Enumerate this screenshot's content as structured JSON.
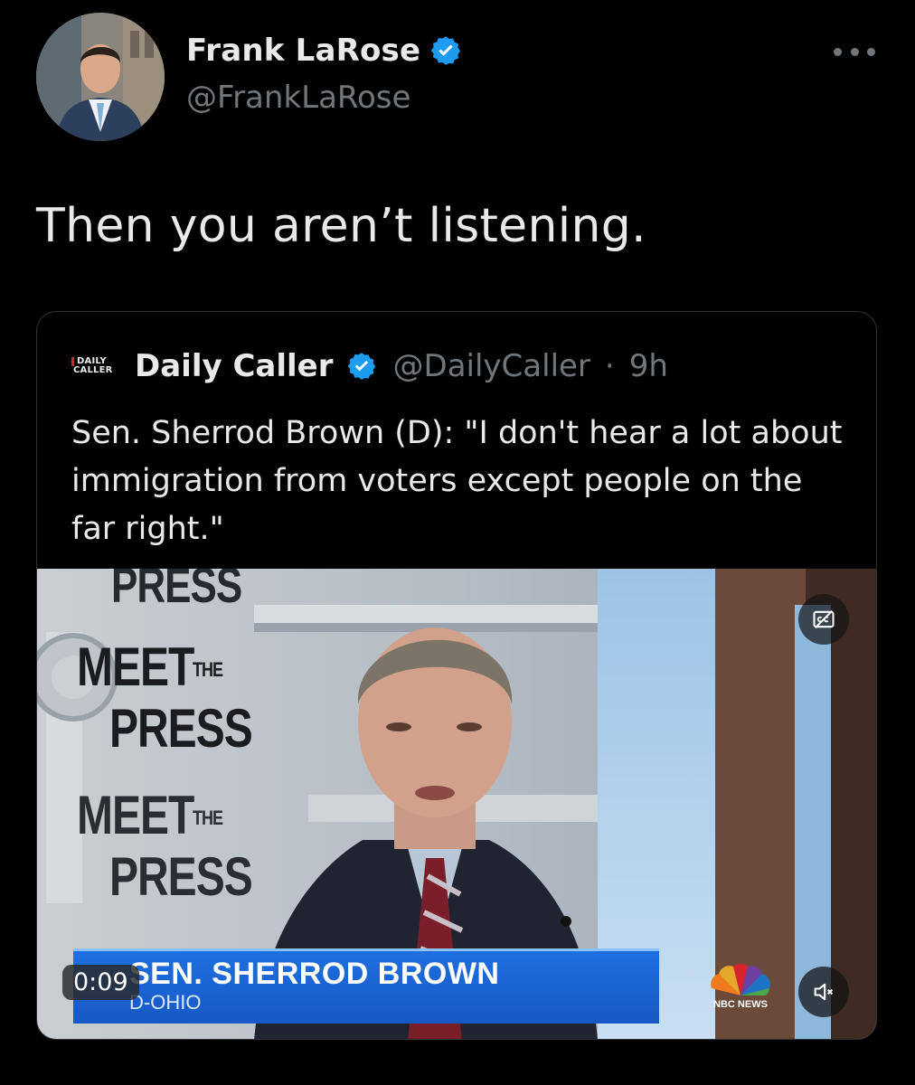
{
  "author": {
    "name": "Frank LaRose",
    "handle": "@FrankLaRose",
    "verified": true,
    "avatar_icon": "profile-photo"
  },
  "tweet": {
    "text": "Then you aren’t listening."
  },
  "quoted_tweet": {
    "logo_line1": "DAILY",
    "logo_line2": "CALLER",
    "name": "Daily Caller",
    "handle": "@DailyCaller",
    "separator": "·",
    "time": "9h",
    "text": "Sen. Sherrod Brown (D): \"I don't hear a lot about immigration from voters except people on the far right.\"",
    "video": {
      "backdrop_text_top": "PRESS",
      "backdrop_meet": "MEET",
      "backdrop_the": "THE",
      "backdrop_press": "PRESS",
      "chyron_name": "SEN. SHERROD BROWN",
      "chyron_sub": "D-OHIO",
      "network": "NBC NEWS",
      "timestamp": "0:09",
      "muted": true
    }
  },
  "colors": {
    "background": "#000000",
    "text": "#e7e9ea",
    "muted": "#71767b",
    "verified": "#1d9bf0",
    "border": "#2f3336",
    "chyron": "#1e6fe0"
  }
}
